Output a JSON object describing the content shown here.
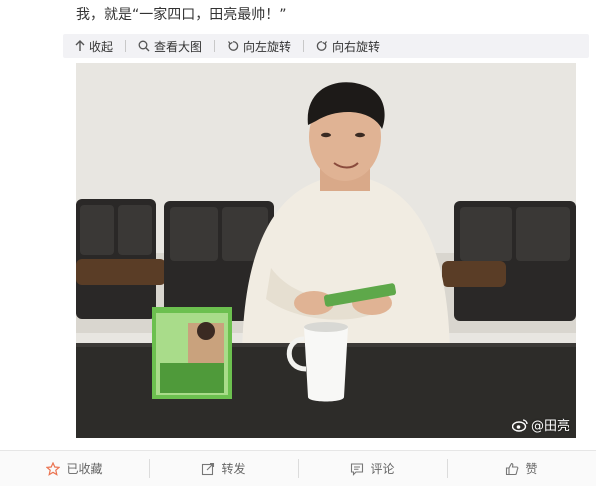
{
  "post": {
    "text": "我，就是“一家四口，田亮最帅！”"
  },
  "toolbar": {
    "collapse": "收起",
    "view_large": "查看大图",
    "rotate_left": "向左旋转",
    "rotate_right": "向右旋转"
  },
  "photo": {
    "watermark": "@田亮"
  },
  "actions": {
    "favorite": "已收藏",
    "repost": "转发",
    "comment": "评论",
    "like": "赞"
  },
  "colors": {
    "favorite_icon": "#eb7350",
    "toolbar_bg": "#f2f2f5",
    "wall": "#e7e5e0",
    "table": "#2b2a28"
  }
}
